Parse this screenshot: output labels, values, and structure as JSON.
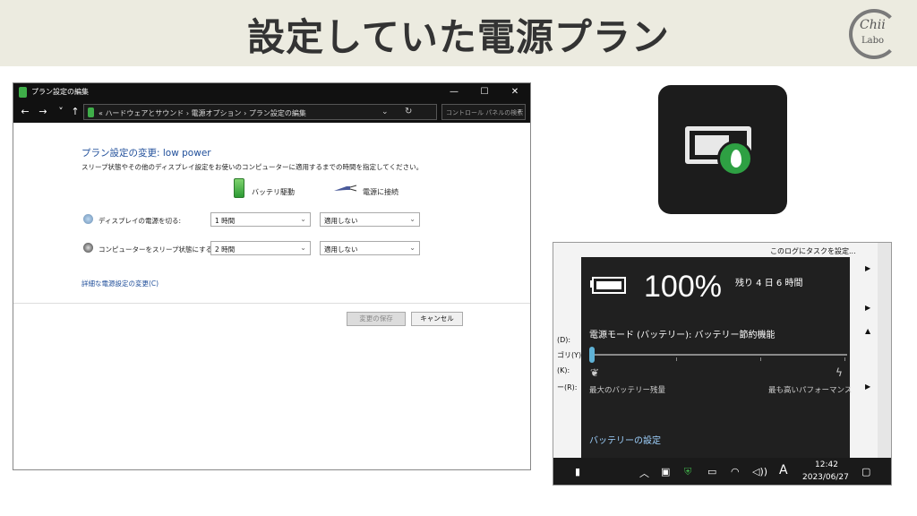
{
  "slide": {
    "title": "設定していた電源プラン",
    "logo_text": "Chii",
    "logo_sub": "Labo"
  },
  "window": {
    "title": "プラン設定の編集",
    "controls": [
      "—",
      "☐",
      "✕"
    ],
    "nav": [
      "←",
      "→",
      "˅",
      "↑"
    ],
    "breadcrumb": "« ハードウェアとサウンド  ›  電源オプション  ›  プラン設定の編集",
    "search_placeholder": "コントロール パネルの検索",
    "heading": "プラン設定の変更: low power",
    "description": "スリープ状態やその他のディスプレイ設定をお使いのコンピューターに適用するまでの時間を指定してください。",
    "col_battery": "バッテリ駆動",
    "col_plugged": "電源に接続",
    "rows": [
      {
        "label": "ディスプレイの電源を切る:",
        "battery": "1 時間",
        "plugged": "適用しない"
      },
      {
        "label": "コンピューターをスリープ状態にする:",
        "battery": "2 時間",
        "plugged": "適用しない"
      }
    ],
    "advanced_link": "詳細な電源設定の変更(C)",
    "save_label": "変更の保存",
    "cancel_label": "キャンセル"
  },
  "flyout": {
    "bg_task": "このログにタスクを設定...",
    "bg_keys": [
      "(D):",
      "ゴリ(Y)",
      "(K):",
      "ー(R):"
    ],
    "percent": "100%",
    "remaining": "残り 4 日 6 時間",
    "mode": "電源モード (バッテリー): バッテリー節約機能",
    "slider_level": 0,
    "min_label": "最大のバッテリー残量",
    "max_label": "最も高いパフォーマンス",
    "settings_link": "バッテリーの設定",
    "taskbar_ime": "A",
    "time": "12:42",
    "date": "2023/06/27"
  },
  "colors": {
    "header_bg": "#ecebe0",
    "link": "#1f4e9a",
    "flyout_bg": "#202020",
    "accent_green": "#2ea043",
    "slider": "#5fb2d6"
  }
}
